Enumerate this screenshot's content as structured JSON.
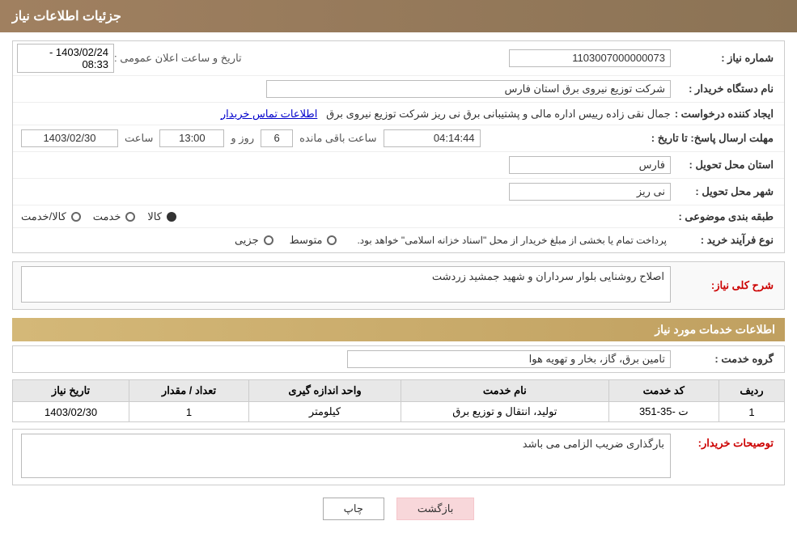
{
  "header": {
    "title": "جزئیات اطلاعات نیاز"
  },
  "fields": {
    "shomareNiaz_label": "شماره نیاز :",
    "shomareNiaz_value": "1103007000000073",
    "namDastgah_label": "نام دستگاه خریدار :",
    "namDastgah_value": "شرکت توزیع نیروی برق استان فارس",
    "ijadKonande_label": "ایجاد کننده درخواست :",
    "ijadKonande_value": "جمال نقی زاده رییس اداره مالی و پشتیبانی برق نی ریز شرکت توزیع نیروی برق",
    "ilamatTamas_link": "اطلاعات تماس خریدار",
    "mohlat_label": "مهلت ارسال پاسخ: تا تاریخ :",
    "date_value": "1403/02/30",
    "saat_label": "ساعت",
    "saat_value": "13:00",
    "roz_label": "روز و",
    "roz_value": "6",
    "remaining_label": "ساعت باقی مانده",
    "remaining_value": "04:14:44",
    "ostan_label": "استان محل تحویل :",
    "ostan_value": "فارس",
    "shahr_label": "شهر محل تحویل :",
    "shahr_value": "نی ریز",
    "tabaghe_label": "طبقه بندی موضوعی :",
    "tabaghe_options": [
      {
        "label": "کالا",
        "selected": true
      },
      {
        "label": "خدمت",
        "selected": false
      },
      {
        "label": "کالا/خدمت",
        "selected": false
      }
    ],
    "noeFarayand_label": "نوع فرآیند خرید :",
    "noeFarayand_note": "پرداخت تمام یا بخشی از مبلغ خریدار از محل \"اسناد خزانه اسلامی\" خواهد بود.",
    "noeFarayand_options": [
      {
        "label": "جزیی",
        "selected": false
      },
      {
        "label": "متوسط",
        "selected": false
      }
    ],
    "announcement_label": "تاریخ و ساعت اعلان عمومی :",
    "announcement_value": "1403/02/24 - 08:33"
  },
  "sharhNiaz": {
    "section_title": "شرح کلی نیاز:",
    "value": "اصلاح روشنایی بلوار سرداران و شهید جمشید زردشت"
  },
  "servicesInfo": {
    "section_title": "اطلاعات خدمات مورد نیاز",
    "grouhKhadamat_label": "گروه خدمت :",
    "grouhKhadamat_value": "تامین برق، گاز، بخار و تهویه هوا",
    "table": {
      "headers": [
        "ردیف",
        "کد خدمت",
        "نام خدمت",
        "واحد اندازه گیری",
        "تعداد / مقدار",
        "تاریخ نیاز"
      ],
      "rows": [
        {
          "radif": "1",
          "kod": "ت -35-351",
          "name": "تولید، انتقال و توزیع برق",
          "vahed": "کیلومتر",
          "tedad": "1",
          "tarikh": "1403/02/30"
        }
      ]
    }
  },
  "toseifKhardar": {
    "label": "توصیحات خریدار:",
    "value": "بارگذاری ضریب الزامی می باشد"
  },
  "buttons": {
    "print_label": "چاپ",
    "back_label": "بازگشت"
  }
}
